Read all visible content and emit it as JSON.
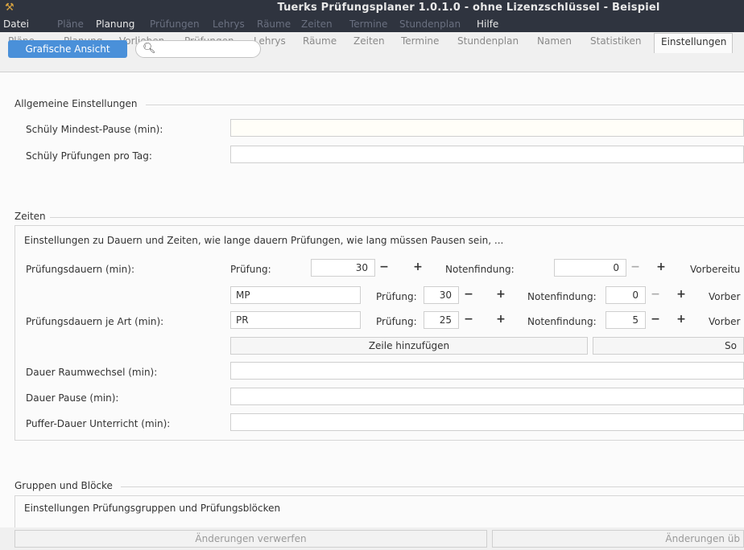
{
  "window": {
    "title": "Tuerks Prüfungsplaner 1.0.1.0 - ohne Lizenzschlüssel - Beispiel",
    "icon": "tool-icon"
  },
  "menubar": {
    "items": [
      {
        "label": "Datei",
        "enabled": true
      },
      {
        "label": "Pläne",
        "enabled": false
      },
      {
        "label": "Planung",
        "enabled": true
      },
      {
        "label": "Prüfungen",
        "enabled": false
      },
      {
        "label": "Lehrys",
        "enabled": false
      },
      {
        "label": "Räume",
        "enabled": false
      },
      {
        "label": "Zeiten",
        "enabled": false
      },
      {
        "label": "Termine",
        "enabled": false
      },
      {
        "label": "Stundenplan",
        "enabled": false
      },
      {
        "label": "Hilfe",
        "enabled": true
      }
    ]
  },
  "tabs": {
    "items": [
      "Pläne",
      "Planung",
      "Vorlieben",
      "Prüfungen",
      "Lehrys",
      "Räume",
      "Zeiten",
      "Termine",
      "Stundenplan",
      "Namen",
      "Statistiken",
      "Einstellungen"
    ],
    "active": "Einstellungen"
  },
  "toolbar": {
    "graphic_view_label": "Grafische Ansicht",
    "search_value": ""
  },
  "general": {
    "title": "Allgemeine Einstellungen",
    "min_pause_label": "Schüly Mindest-Pause (min):",
    "min_pause_value": "",
    "exams_per_day_label": "Schüly Prüfungen pro Tag:",
    "exams_per_day_value": ""
  },
  "times": {
    "title": "Zeiten",
    "description": "Einstellungen zu Dauern und Zeiten, wie lange dauern Prüfungen, wie lang müssen Pausen sein, ...",
    "durations_label": "Prüfungsdauern (min):",
    "exam_label": "Prüfung:",
    "exam_value": "30",
    "grading_label": "Notenfindung:",
    "grading_value": "0",
    "prep_label": "Vorbereitu",
    "by_type_label": "Prüfungsdauern je Art (min):",
    "rows": [
      {
        "type": "MP",
        "exam_label": "Prüfung:",
        "exam": "30",
        "grading_label": "Notenfindung:",
        "grading": "0",
        "prep_label": "Vorber"
      },
      {
        "type": "PR",
        "exam_label": "Prüfung:",
        "exam": "25",
        "grading_label": "Notenfindung:",
        "grading": "5",
        "prep_label": "Vorber"
      }
    ],
    "add_row_label": "Zeile hinzufügen",
    "sort_label": "So",
    "room_change_label": "Dauer Raumwechsel (min):",
    "room_change_value": "",
    "pause_label": "Dauer Pause (min):",
    "pause_value": "",
    "buffer_label": "Puffer-Dauer Unterricht (min):",
    "buffer_value": ""
  },
  "groups": {
    "title": "Gruppen und Blöcke",
    "description": "Einstellungen Prüfungsgruppen und Prüfungsblöcken"
  },
  "footer": {
    "discard_label": "Änderungen verwerfen",
    "apply_label": "Änderungen üb"
  },
  "icons": {
    "search": "search-icon",
    "plus": "plus-icon",
    "minus": "minus-icon"
  }
}
